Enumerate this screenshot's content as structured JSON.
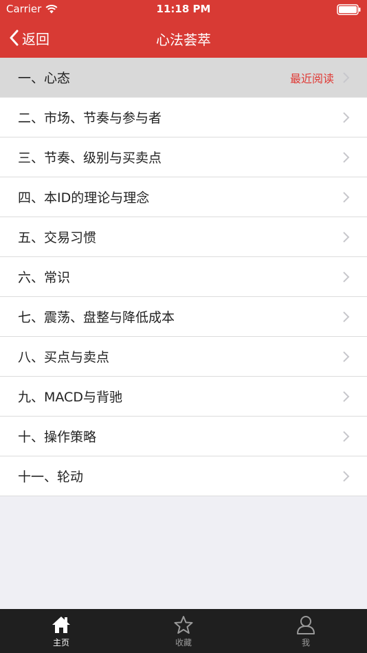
{
  "status": {
    "carrier": "Carrier",
    "time": "11:18 PM"
  },
  "nav": {
    "back_label": "返回",
    "title": "心法荟萃"
  },
  "chapters": [
    {
      "label": "一、心态",
      "recent": "最近阅读"
    },
    {
      "label": "二、市场、节奏与参与者"
    },
    {
      "label": "三、节奏、级别与买卖点"
    },
    {
      "label": "四、本ID的理论与理念"
    },
    {
      "label": "五、交易习惯"
    },
    {
      "label": "六、常识"
    },
    {
      "label": "七、震荡、盘整与降低成本"
    },
    {
      "label": "八、买点与卖点"
    },
    {
      "label": "九、MACD与背驰"
    },
    {
      "label": "十、操作策略"
    },
    {
      "label": "十一、轮动"
    }
  ],
  "tabs": [
    {
      "label": "主页",
      "icon": "home-icon"
    },
    {
      "label": "收藏",
      "icon": "star-icon"
    },
    {
      "label": "我",
      "icon": "person-icon"
    }
  ],
  "colors": {
    "brand": "#d83a34",
    "recent": "#e03a35",
    "tabbar": "#1f1f1f",
    "background": "#efeff4"
  }
}
